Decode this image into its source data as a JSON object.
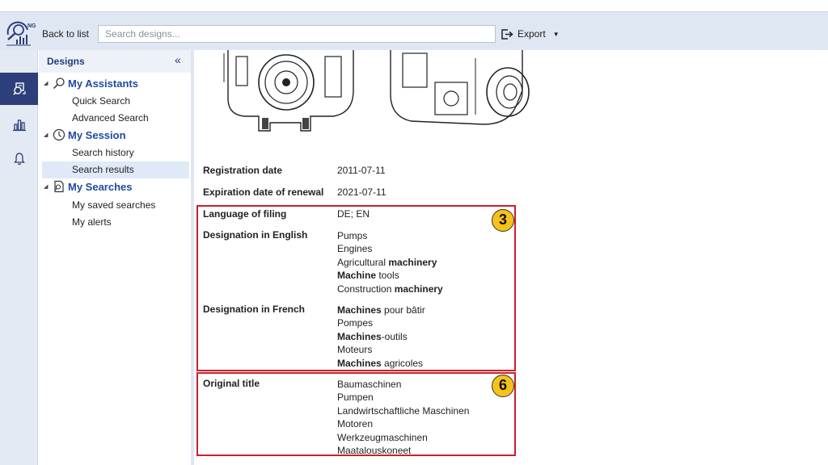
{
  "toolbar": {
    "back_label": "Back to list",
    "search_placeholder": "Search designs...",
    "export_label": "Export",
    "logo_text": "NG"
  },
  "rail": {
    "items": [
      {
        "icon": "design-search-icon",
        "active": true
      },
      {
        "icon": "bar-chart-icon",
        "active": false
      },
      {
        "icon": "bell-icon",
        "active": false
      }
    ]
  },
  "nav": {
    "title": "Designs",
    "collapse_glyph": "«",
    "groups": [
      {
        "label": "My Assistants",
        "icon": "magnifier-icon",
        "items": [
          "Quick Search",
          "Advanced Search"
        ]
      },
      {
        "label": "My Session",
        "icon": "clock-icon",
        "items": [
          "Search history",
          "Search results"
        ]
      },
      {
        "label": "My Searches",
        "icon": "saved-search-icon",
        "items": [
          "My saved searches",
          "My alerts"
        ]
      }
    ],
    "selected_item": "Search results"
  },
  "details": {
    "registration": {
      "label": "Registration date",
      "value": "2011-07-11"
    },
    "expiration": {
      "label": "Expiration date of renewal",
      "value": "2021-07-11"
    },
    "language": {
      "label": "Language of filing",
      "value": "DE; EN"
    },
    "english": {
      "label": "Designation in English",
      "values": [
        [
          {
            "t": "Pumps",
            "b": false
          }
        ],
        [
          {
            "t": "Engines",
            "b": false
          }
        ],
        [
          {
            "t": "Agricultural ",
            "b": false
          },
          {
            "t": "machinery",
            "b": true
          }
        ],
        [
          {
            "t": "Machine",
            "b": true
          },
          {
            "t": " tools",
            "b": false
          }
        ],
        [
          {
            "t": "Construction ",
            "b": false
          },
          {
            "t": "machinery",
            "b": true
          }
        ]
      ]
    },
    "french": {
      "label": "Designation in French",
      "values": [
        [
          {
            "t": "Machines",
            "b": true
          },
          {
            "t": " pour bâtir",
            "b": false
          }
        ],
        [
          {
            "t": "Pompes",
            "b": false
          }
        ],
        [
          {
            "t": "Machines",
            "b": true
          },
          {
            "t": "-outils",
            "b": false
          }
        ],
        [
          {
            "t": "Moteurs",
            "b": false
          }
        ],
        [
          {
            "t": "Machines",
            "b": true
          },
          {
            "t": " agricoles",
            "b": false
          }
        ]
      ]
    },
    "original": {
      "label": "Original title",
      "values": [
        "Baumaschinen",
        "Pumpen",
        "Landwirtschaftliche Maschinen",
        "Motoren",
        "Werkzeugmaschinen",
        "Maatalouskoneet"
      ]
    }
  },
  "annotations": {
    "badge_3": "3",
    "badge_6": "6",
    "box_color": "#cc1f2a",
    "badge_color": "#f5c21a"
  }
}
